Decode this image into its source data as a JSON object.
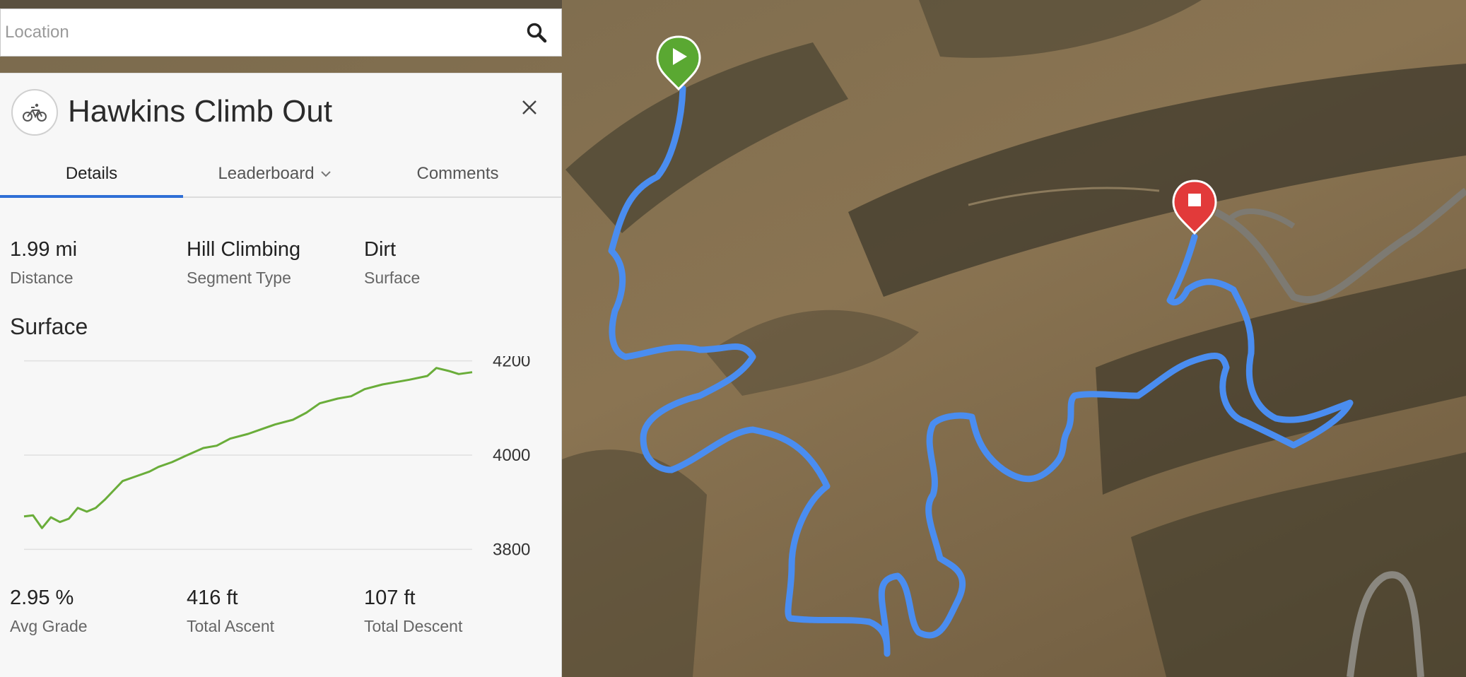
{
  "search": {
    "placeholder": "Location"
  },
  "segment": {
    "title": "Hawkins Climb Out",
    "sport_icon": "bicycle-icon"
  },
  "tabs": [
    {
      "label": "Details",
      "active": true
    },
    {
      "label": "Leaderboard",
      "active": false,
      "icon": "chevron-down-icon"
    },
    {
      "label": "Comments",
      "active": false
    }
  ],
  "stats_top": [
    {
      "value": "1.99 mi",
      "label": "Distance"
    },
    {
      "value": "Hill Climbing",
      "label": "Segment Type"
    },
    {
      "value": "Dirt",
      "label": "Surface"
    }
  ],
  "section_title": "Surface",
  "stats_bottom": [
    {
      "value": "2.95 %",
      "label": "Avg Grade"
    },
    {
      "value": "416 ft",
      "label": "Total Ascent"
    },
    {
      "value": "107 ft",
      "label": "Total Descent"
    }
  ],
  "colors": {
    "accent": "#2f6fd6",
    "elevation_line": "#6aad3a",
    "route_line": "#4a8df0",
    "start_marker": "#5aa832",
    "end_marker": "#e23a3a"
  },
  "chart_data": {
    "type": "line",
    "title": "",
    "xlabel": "",
    "ylabel": "",
    "ylim": [
      3760,
      4210
    ],
    "yticks": [
      4200,
      4000,
      3800
    ],
    "series": [
      {
        "x": [
          0,
          0.02,
          0.04,
          0.06,
          0.08,
          0.1,
          0.12,
          0.14,
          0.16,
          0.18,
          0.2,
          0.22,
          0.25,
          0.28,
          0.3,
          0.33,
          0.36,
          0.4,
          0.43,
          0.46,
          0.5,
          0.53,
          0.56,
          0.6,
          0.63,
          0.66,
          0.7,
          0.73,
          0.76,
          0.8,
          0.83,
          0.86,
          0.9,
          0.92,
          0.95,
          0.97,
          1.0
        ],
        "values": [
          3870,
          3872,
          3845,
          3868,
          3858,
          3865,
          3888,
          3880,
          3888,
          3905,
          3925,
          3945,
          3955,
          3965,
          3975,
          3985,
          3998,
          4015,
          4020,
          4035,
          4045,
          4055,
          4065,
          4075,
          4090,
          4110,
          4120,
          4125,
          4140,
          4150,
          4155,
          4160,
          4168,
          4185,
          4178,
          4172,
          4176
        ]
      }
    ]
  }
}
